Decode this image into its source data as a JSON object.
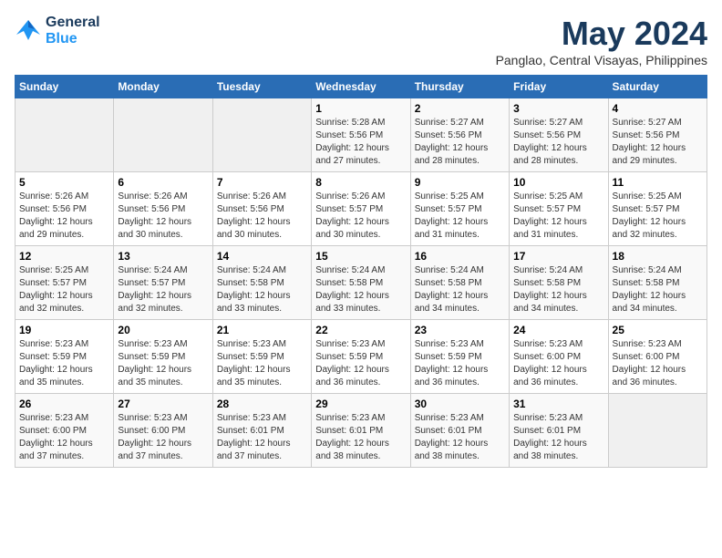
{
  "header": {
    "logo_line1": "General",
    "logo_line2": "Blue",
    "month_title": "May 2024",
    "subtitle": "Panglao, Central Visayas, Philippines"
  },
  "days_of_week": [
    "Sunday",
    "Monday",
    "Tuesday",
    "Wednesday",
    "Thursday",
    "Friday",
    "Saturday"
  ],
  "weeks": [
    [
      {
        "day": "",
        "info": ""
      },
      {
        "day": "",
        "info": ""
      },
      {
        "day": "",
        "info": ""
      },
      {
        "day": "1",
        "info": "Sunrise: 5:28 AM\nSunset: 5:56 PM\nDaylight: 12 hours\nand 27 minutes."
      },
      {
        "day": "2",
        "info": "Sunrise: 5:27 AM\nSunset: 5:56 PM\nDaylight: 12 hours\nand 28 minutes."
      },
      {
        "day": "3",
        "info": "Sunrise: 5:27 AM\nSunset: 5:56 PM\nDaylight: 12 hours\nand 28 minutes."
      },
      {
        "day": "4",
        "info": "Sunrise: 5:27 AM\nSunset: 5:56 PM\nDaylight: 12 hours\nand 29 minutes."
      }
    ],
    [
      {
        "day": "5",
        "info": "Sunrise: 5:26 AM\nSunset: 5:56 PM\nDaylight: 12 hours\nand 29 minutes."
      },
      {
        "day": "6",
        "info": "Sunrise: 5:26 AM\nSunset: 5:56 PM\nDaylight: 12 hours\nand 30 minutes."
      },
      {
        "day": "7",
        "info": "Sunrise: 5:26 AM\nSunset: 5:56 PM\nDaylight: 12 hours\nand 30 minutes."
      },
      {
        "day": "8",
        "info": "Sunrise: 5:26 AM\nSunset: 5:57 PM\nDaylight: 12 hours\nand 30 minutes."
      },
      {
        "day": "9",
        "info": "Sunrise: 5:25 AM\nSunset: 5:57 PM\nDaylight: 12 hours\nand 31 minutes."
      },
      {
        "day": "10",
        "info": "Sunrise: 5:25 AM\nSunset: 5:57 PM\nDaylight: 12 hours\nand 31 minutes."
      },
      {
        "day": "11",
        "info": "Sunrise: 5:25 AM\nSunset: 5:57 PM\nDaylight: 12 hours\nand 32 minutes."
      }
    ],
    [
      {
        "day": "12",
        "info": "Sunrise: 5:25 AM\nSunset: 5:57 PM\nDaylight: 12 hours\nand 32 minutes."
      },
      {
        "day": "13",
        "info": "Sunrise: 5:24 AM\nSunset: 5:57 PM\nDaylight: 12 hours\nand 32 minutes."
      },
      {
        "day": "14",
        "info": "Sunrise: 5:24 AM\nSunset: 5:58 PM\nDaylight: 12 hours\nand 33 minutes."
      },
      {
        "day": "15",
        "info": "Sunrise: 5:24 AM\nSunset: 5:58 PM\nDaylight: 12 hours\nand 33 minutes."
      },
      {
        "day": "16",
        "info": "Sunrise: 5:24 AM\nSunset: 5:58 PM\nDaylight: 12 hours\nand 34 minutes."
      },
      {
        "day": "17",
        "info": "Sunrise: 5:24 AM\nSunset: 5:58 PM\nDaylight: 12 hours\nand 34 minutes."
      },
      {
        "day": "18",
        "info": "Sunrise: 5:24 AM\nSunset: 5:58 PM\nDaylight: 12 hours\nand 34 minutes."
      }
    ],
    [
      {
        "day": "19",
        "info": "Sunrise: 5:23 AM\nSunset: 5:59 PM\nDaylight: 12 hours\nand 35 minutes."
      },
      {
        "day": "20",
        "info": "Sunrise: 5:23 AM\nSunset: 5:59 PM\nDaylight: 12 hours\nand 35 minutes."
      },
      {
        "day": "21",
        "info": "Sunrise: 5:23 AM\nSunset: 5:59 PM\nDaylight: 12 hours\nand 35 minutes."
      },
      {
        "day": "22",
        "info": "Sunrise: 5:23 AM\nSunset: 5:59 PM\nDaylight: 12 hours\nand 36 minutes."
      },
      {
        "day": "23",
        "info": "Sunrise: 5:23 AM\nSunset: 5:59 PM\nDaylight: 12 hours\nand 36 minutes."
      },
      {
        "day": "24",
        "info": "Sunrise: 5:23 AM\nSunset: 6:00 PM\nDaylight: 12 hours\nand 36 minutes."
      },
      {
        "day": "25",
        "info": "Sunrise: 5:23 AM\nSunset: 6:00 PM\nDaylight: 12 hours\nand 36 minutes."
      }
    ],
    [
      {
        "day": "26",
        "info": "Sunrise: 5:23 AM\nSunset: 6:00 PM\nDaylight: 12 hours\nand 37 minutes."
      },
      {
        "day": "27",
        "info": "Sunrise: 5:23 AM\nSunset: 6:00 PM\nDaylight: 12 hours\nand 37 minutes."
      },
      {
        "day": "28",
        "info": "Sunrise: 5:23 AM\nSunset: 6:01 PM\nDaylight: 12 hours\nand 37 minutes."
      },
      {
        "day": "29",
        "info": "Sunrise: 5:23 AM\nSunset: 6:01 PM\nDaylight: 12 hours\nand 38 minutes."
      },
      {
        "day": "30",
        "info": "Sunrise: 5:23 AM\nSunset: 6:01 PM\nDaylight: 12 hours\nand 38 minutes."
      },
      {
        "day": "31",
        "info": "Sunrise: 5:23 AM\nSunset: 6:01 PM\nDaylight: 12 hours\nand 38 minutes."
      },
      {
        "day": "",
        "info": ""
      }
    ]
  ]
}
